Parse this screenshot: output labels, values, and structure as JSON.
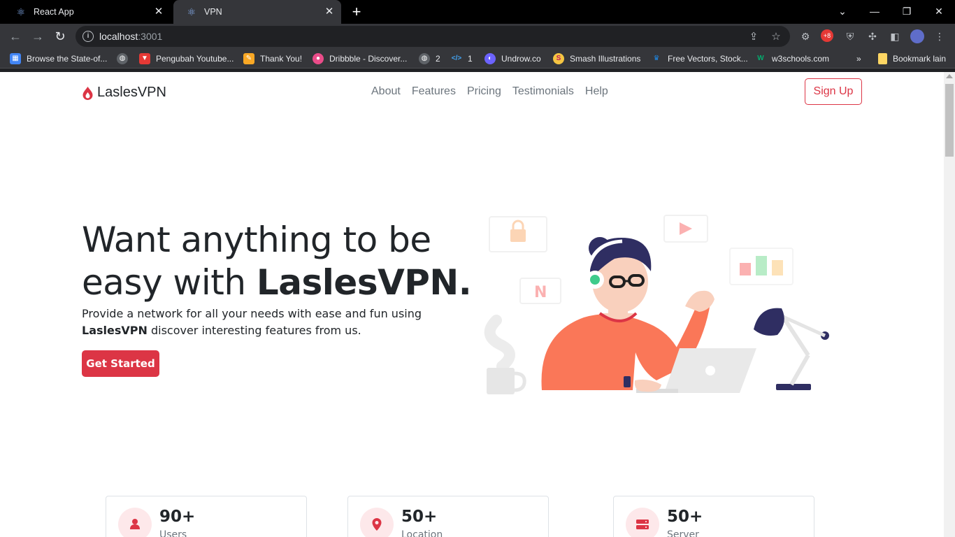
{
  "browser": {
    "tabs": [
      {
        "title": "React App",
        "active": false
      },
      {
        "title": "VPN",
        "active": true
      }
    ],
    "url_host": "localhost",
    "url_port": ":3001",
    "bookmarks": [
      {
        "label": "Browse the State-of...",
        "icon": "grid-icon",
        "color": "#4285f4"
      },
      {
        "label": "",
        "icon": "globe-icon",
        "color": "#9aa0a6"
      },
      {
        "label": "Pengubah Youtube...",
        "icon": "download-icon",
        "color": "#e53935"
      },
      {
        "label": "Thank You!",
        "icon": "pencil-icon",
        "color": "#f9a825"
      },
      {
        "label": "Dribbble - Discover...",
        "icon": "dribbble-icon",
        "color": "#ea4c89"
      },
      {
        "label": "2",
        "icon": "globe-icon",
        "color": "#9aa0a6"
      },
      {
        "label": "1",
        "icon": "code-icon",
        "color": "#42a5f5"
      },
      {
        "label": "Undrow.co",
        "icon": "undraw-icon",
        "color": "#6c63ff"
      },
      {
        "label": "Smash Illustrations",
        "icon": "smash-icon",
        "color": "#f5c542"
      },
      {
        "label": "Free Vectors, Stock...",
        "icon": "freepik-icon",
        "color": "#1e88e5"
      },
      {
        "label": "w3schools.com",
        "icon": "w3-icon",
        "color": "#04aa6d"
      }
    ],
    "other_bookmarks": "Bookmark lain"
  },
  "site": {
    "brand": "LaslesVPN",
    "nav": [
      "About",
      "Features",
      "Pricing",
      "Testimonials",
      "Help"
    ],
    "signup": "Sign Up",
    "hero": {
      "title_plain": "Want anything to be easy with ",
      "title_bold": "LaslesVPN.",
      "desc_before": "Provide a network for all your needs with ease and fun using ",
      "desc_bold": "LaslesVPN",
      "desc_after": " discover interesting features from us.",
      "cta": "Get Started"
    },
    "stats": [
      {
        "value": "90+",
        "label": "Users",
        "icon": "user-icon"
      },
      {
        "value": "50+",
        "label": "Location",
        "icon": "location-pin-icon"
      },
      {
        "value": "50+",
        "label": "Server",
        "icon": "server-icon"
      }
    ],
    "accent": "#dc3545"
  }
}
